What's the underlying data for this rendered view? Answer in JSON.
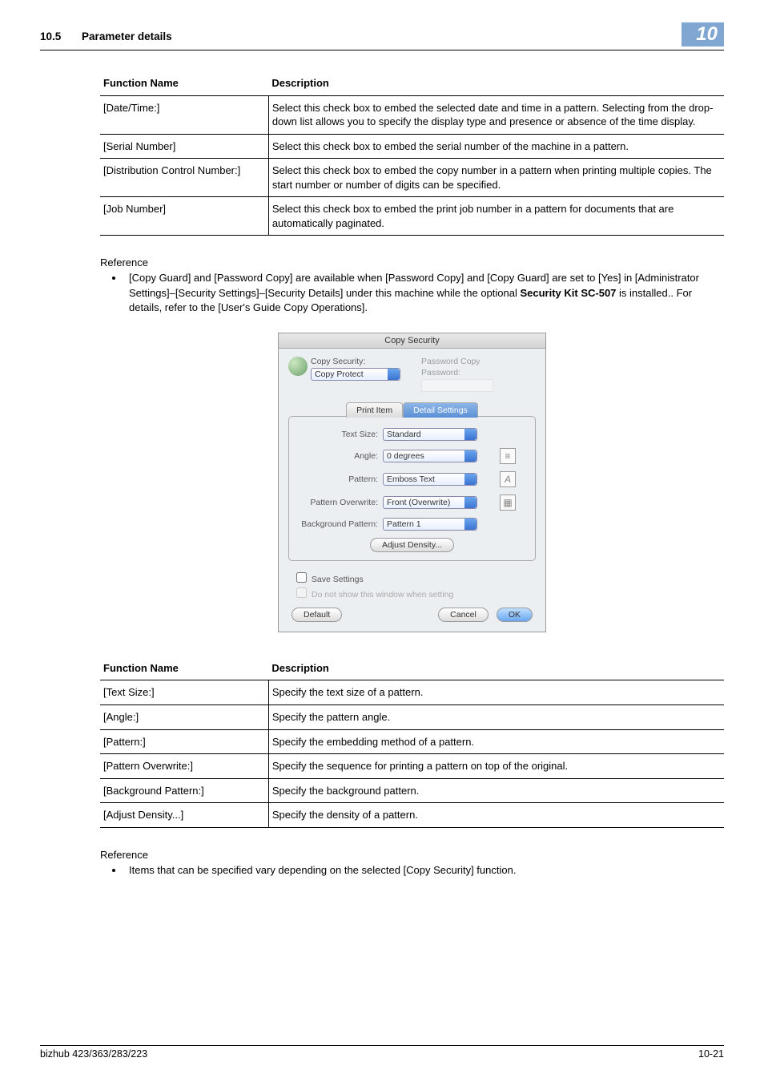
{
  "header": {
    "section_number": "10.5",
    "section_title": "Parameter details",
    "chapter_number": "10"
  },
  "table1": {
    "head_name": "Function Name",
    "head_desc": "Description",
    "rows": [
      {
        "name": "[Date/Time:]",
        "desc": "Select this check box to embed the selected date and time in a pattern. Selecting from the drop-down list allows you to specify the display type and presence or absence of the time display."
      },
      {
        "name": "[Serial Number]",
        "desc": "Select this check box to embed the serial number of the machine in a pattern."
      },
      {
        "name": "[Distribution Control Number:]",
        "desc": "Select this check box to embed the copy number in a pattern when printing multiple copies. The start number or number of digits can be specified."
      },
      {
        "name": "[Job Number]",
        "desc": "Select this check box to embed the print job number in a pattern for documents that are automatically paginated."
      }
    ]
  },
  "reference1": {
    "label": "Reference",
    "item_pre": "[Copy Guard] and [Password Copy] are available when [Password Copy] and [Copy Guard] are set to [Yes] in [Administrator Settings]–[Security Settings]–[Security Details] under this machine while the optional ",
    "item_bold": "Security Kit SC-507",
    "item_post": " is installed.. For details, refer to the [User's Guide Copy Operations]."
  },
  "dialog": {
    "title": "Copy Security",
    "copy_security_label": "Copy Security:",
    "copy_security_value": "Copy Protect",
    "password_copy_label": "Password Copy",
    "password_label": "Password:",
    "tab_print": "Print Item",
    "tab_detail": "Detail Settings",
    "text_size_label": "Text Size:",
    "text_size_value": "Standard",
    "angle_label": "Angle:",
    "angle_value": "0 degrees",
    "pattern_label": "Pattern:",
    "pattern_value": "Emboss Text",
    "pattern_overwrite_label": "Pattern Overwrite:",
    "pattern_overwrite_value": "Front (Overwrite)",
    "background_pattern_label": "Background Pattern:",
    "background_pattern_value": "Pattern 1",
    "adjust_density": "Adjust Density...",
    "save_settings": "Save Settings",
    "do_not_show": "Do not show this window when setting",
    "default_btn": "Default",
    "cancel_btn": "Cancel",
    "ok_btn": "OK"
  },
  "table2": {
    "head_name": "Function Name",
    "head_desc": "Description",
    "rows": [
      {
        "name": "[Text Size:]",
        "desc": "Specify the text size of a pattern."
      },
      {
        "name": "[Angle:]",
        "desc": "Specify the pattern angle."
      },
      {
        "name": "[Pattern:]",
        "desc": "Specify the embedding method of a pattern."
      },
      {
        "name": "[Pattern Overwrite:]",
        "desc": "Specify the sequence for printing a pattern on top of the original."
      },
      {
        "name": "[Background Pattern:]",
        "desc": "Specify the background pattern."
      },
      {
        "name": "[Adjust Density...]",
        "desc": "Specify the density of a pattern."
      }
    ]
  },
  "reference2": {
    "label": "Reference",
    "item": "Items that can be specified vary depending on the selected [Copy Security] function."
  },
  "footer": {
    "left": "bizhub 423/363/283/223",
    "right": "10-21"
  }
}
